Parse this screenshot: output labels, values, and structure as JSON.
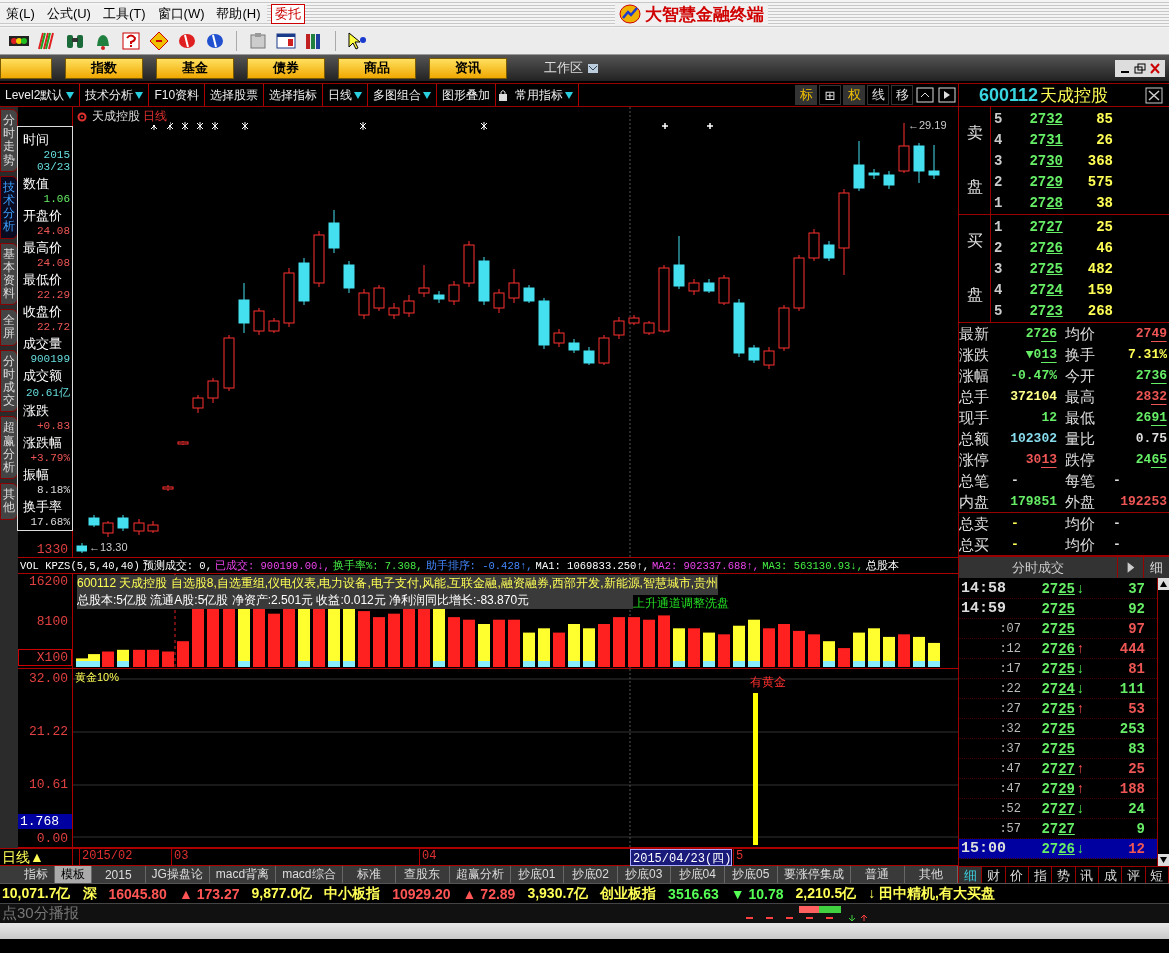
{
  "menu": [
    {
      "label": "策(L)",
      "kind": "plain"
    },
    {
      "label": "公式(U)",
      "kind": "plain"
    },
    {
      "label": "工具(T)",
      "kind": "plain"
    },
    {
      "label": "窗口(W)",
      "kind": "plain"
    },
    {
      "label": "帮助(H)",
      "kind": "plain"
    },
    {
      "label": "委托",
      "kind": "boxed"
    }
  ],
  "app_title": "大智慧金融终端",
  "nav_buttons": [
    "指数",
    "基金",
    "债券",
    "商品",
    "资讯"
  ],
  "workspace": "工作区",
  "chart_toolbar": [
    {
      "label": "Level2默认",
      "dropdown": true
    },
    {
      "label": "技术分析",
      "dropdown": true
    },
    {
      "label": "F10资料",
      "dropdown": false
    },
    {
      "label": "选择股票",
      "dropdown": false
    },
    {
      "label": "选择指标",
      "dropdown": false
    },
    {
      "label": "日线",
      "dropdown": true
    },
    {
      "label": "多图组合",
      "dropdown": true
    },
    {
      "label": "图形叠加",
      "dropdown": false
    },
    {
      "label": "常用指标",
      "dropdown": true
    }
  ],
  "view_buttons": [
    {
      "label": "标",
      "selected": true
    },
    {
      "label": "⊞",
      "selected": false
    },
    {
      "label": "权",
      "selected": true
    },
    {
      "label": "线",
      "selected": false
    },
    {
      "label": "移",
      "selected": false
    }
  ],
  "side_tabs": [
    {
      "label": "分时走势",
      "selected": false
    },
    {
      "label": "技术分析",
      "selected": true
    },
    {
      "label": "基本资料",
      "selected": false
    },
    {
      "label": "全屏",
      "selected": false
    },
    {
      "label": "分时成交",
      "selected": false
    },
    {
      "label": "超赢分析",
      "selected": false
    },
    {
      "label": "其他",
      "selected": false
    }
  ],
  "chart": {
    "stock": "天成控股",
    "period": "日线",
    "max_label": "←29.19",
    "min_label": "←13.30",
    "price_axis": [
      "1330"
    ]
  },
  "info_box": [
    {
      "label": "时间",
      "values": [
        "2015",
        "03/23"
      ],
      "kind": "time"
    },
    {
      "label": "数值",
      "values": [
        "1.06"
      ],
      "kind": "value"
    },
    {
      "label": "开盘价",
      "values": [
        "24.08"
      ],
      "kind": "price"
    },
    {
      "label": "最高价",
      "values": [
        "24.08"
      ],
      "kind": "price"
    },
    {
      "label": "最低价",
      "values": [
        "22.29"
      ],
      "kind": "price"
    },
    {
      "label": "收盘价",
      "values": [
        "22.72"
      ],
      "kind": "price"
    },
    {
      "label": "成交量",
      "values": [
        "900199"
      ],
      "kind": "amount"
    },
    {
      "label": "成交额",
      "values": [
        "20.61亿"
      ],
      "kind": "amount"
    },
    {
      "label": "涨跌",
      "values": [
        "+0.83"
      ],
      "kind": "price"
    },
    {
      "label": "涨跌幅",
      "values": [
        "+3.79%"
      ],
      "kind": "price"
    },
    {
      "label": "振幅",
      "values": [
        "8.18%"
      ],
      "kind": "ratio"
    },
    {
      "label": "换手率",
      "values": [
        "17.68%"
      ],
      "kind": "ratio"
    }
  ],
  "volume": {
    "header": [
      {
        "text": "VOL KPZS(5,5,40,40)",
        "kind": "label"
      },
      {
        "text": "预测成交: 0,",
        "kind": "label"
      },
      {
        "text": "已成交: 900199.00↓,",
        "kind": "traded"
      },
      {
        "text": "换手率%: 7.308,",
        "kind": "turnover"
      },
      {
        "text": "助手排序: -0.428↑,",
        "kind": "rank"
      },
      {
        "text": "MA1: 1069833.250↑,",
        "kind": "label"
      },
      {
        "text": "MA2: 902337.688↑,",
        "kind": "traded"
      },
      {
        "text": "MA3: 563130.93↓,",
        "kind": "turnover"
      },
      {
        "text": "总股本",
        "kind": "label"
      }
    ],
    "info_lines": [
      "600112 天成控股 自选股8,自选重组,仪电仪表,电力设备,电子支付,风能,互联金融,融资融券,西部开发,新能源,智慧城市,贵州",
      "总股本:5亿股 流通A股:5亿股 净资产:2.501元 收益:0.012元 净利润同比增长:-83.870元"
    ],
    "pattern": "上升通道调整洗盘",
    "axis": [
      "16200",
      "8100",
      "X100"
    ]
  },
  "indicator": {
    "name": "黄金10%",
    "signal": "有黄金",
    "axis": [
      "32.00",
      "21.22",
      "10.61",
      "0.00"
    ],
    "current": "1.768"
  },
  "date_axis": {
    "period": "日线▲",
    "labels": [
      {
        "text": "2015/02",
        "selected": false
      },
      {
        "text": "03",
        "selected": false
      },
      {
        "text": "04",
        "selected": false
      },
      {
        "text": "2015/04/23(四)",
        "selected": true
      },
      {
        "text": "5",
        "selected": false
      }
    ]
  },
  "bottom_tabs": [
    {
      "label": "指标",
      "selected": false
    },
    {
      "label": "模板",
      "selected": true
    },
    {
      "label": "2015",
      "selected": false
    },
    {
      "label": "JG操盘论",
      "selected": false
    },
    {
      "label": "macd背离",
      "selected": false
    },
    {
      "label": "macd综合",
      "selected": false
    },
    {
      "label": "标准",
      "selected": false
    },
    {
      "label": "查股东",
      "selected": false
    },
    {
      "label": "超赢分析",
      "selected": false
    },
    {
      "label": "抄底01",
      "selected": false
    },
    {
      "label": "抄底02",
      "selected": false
    },
    {
      "label": "抄底03",
      "selected": false
    },
    {
      "label": "抄底04",
      "selected": false
    },
    {
      "label": "抄底05",
      "selected": false
    },
    {
      "label": "要涨停集成",
      "selected": false
    },
    {
      "label": "普通",
      "selected": false
    },
    {
      "label": "其他",
      "selected": false
    }
  ],
  "ticker": [
    {
      "text": "10,071.7亿",
      "kind": "label"
    },
    {
      "text": "深",
      "kind": "label"
    },
    {
      "text": "16045.80",
      "kind": "up"
    },
    {
      "text": "▲ 173.27",
      "kind": "up"
    },
    {
      "text": "9,877.0亿",
      "kind": "label"
    },
    {
      "text": "中小板指",
      "kind": "label"
    },
    {
      "text": "10929.20",
      "kind": "up"
    },
    {
      "text": "▲ 72.89",
      "kind": "up"
    },
    {
      "text": "3,930.7亿",
      "kind": "label"
    },
    {
      "text": "创业板指",
      "kind": "label"
    },
    {
      "text": "3516.63",
      "kind": "down"
    },
    {
      "text": "▼ 10.78",
      "kind": "down"
    },
    {
      "text": "2,210.5亿",
      "kind": "label"
    },
    {
      "text": "↓ 田中精机,有大买盘",
      "kind": "label"
    }
  ],
  "status": "点30分播报",
  "quote": {
    "code": "600112",
    "name": "天成控股",
    "sell_label": [
      "卖",
      "盘"
    ],
    "buy_label": [
      "买",
      "盘"
    ],
    "sell": [
      {
        "rank": "5",
        "price": "2732",
        "volume": "85"
      },
      {
        "rank": "4",
        "price": "2731",
        "volume": "26"
      },
      {
        "rank": "3",
        "price": "2730",
        "volume": "368"
      },
      {
        "rank": "2",
        "price": "2729",
        "volume": "575"
      },
      {
        "rank": "1",
        "price": "2728",
        "volume": "38"
      }
    ],
    "buy": [
      {
        "rank": "1",
        "price": "2727",
        "volume": "25"
      },
      {
        "rank": "2",
        "price": "2726",
        "volume": "46"
      },
      {
        "rank": "3",
        "price": "2725",
        "volume": "482"
      },
      {
        "rank": "4",
        "price": "2724",
        "volume": "159"
      },
      {
        "rank": "5",
        "price": "2723",
        "volume": "268"
      }
    ],
    "stats": [
      {
        "label": "最新",
        "value": "2726",
        "kind": "down",
        "underlined": true
      },
      {
        "label": "均价",
        "value": "2749",
        "kind": "up",
        "underlined": true
      },
      {
        "label": "涨跌",
        "value": "▼013",
        "kind": "down",
        "underlined": true
      },
      {
        "label": "换手",
        "value": "7.31%",
        "kind": "rate",
        "underlined": false
      },
      {
        "label": "涨幅",
        "value": "-0.47%",
        "kind": "down",
        "underlined": false
      },
      {
        "label": "今开",
        "value": "2736",
        "kind": "down",
        "underlined": true
      },
      {
        "label": "总手",
        "value": "372104",
        "kind": "volume",
        "underlined": false
      },
      {
        "label": "最高",
        "value": "2832",
        "kind": "up",
        "underlined": true
      },
      {
        "label": "现手",
        "value": "12",
        "kind": "down",
        "underlined": false
      },
      {
        "label": "最低",
        "value": "2691",
        "kind": "down",
        "underlined": true
      },
      {
        "label": "总额",
        "value": "102302",
        "kind": "amount",
        "underlined": false
      },
      {
        "label": "量比",
        "value": "0.75",
        "kind": "neutral",
        "underlined": false
      },
      {
        "label": "涨停",
        "value": "3013",
        "kind": "up",
        "underlined": true
      },
      {
        "label": "跌停",
        "value": "2465",
        "kind": "down",
        "underlined": true
      },
      {
        "label": "总笔",
        "value": "-",
        "kind": "neutral",
        "underlined": false
      },
      {
        "label": "每笔",
        "value": "-",
        "kind": "neutral",
        "underlined": false
      },
      {
        "label": "内盘",
        "value": "179851",
        "kind": "down",
        "underlined": false
      },
      {
        "label": "外盘",
        "value": "192253",
        "kind": "up",
        "underlined": false
      }
    ],
    "totals": [
      {
        "label": "总卖",
        "value": "-",
        "kind": "rate",
        "underlined": false
      },
      {
        "label": "均价",
        "value": "-",
        "kind": "neutral",
        "underlined": false
      },
      {
        "label": "总买",
        "value": "-",
        "kind": "rate",
        "underlined": false
      },
      {
        "label": "均价",
        "value": "-",
        "kind": "neutral",
        "underlined": false
      }
    ],
    "trades_title": "分时成交",
    "trades_detail": "细",
    "trades": [
      {
        "time": "14:58",
        "kind": "full",
        "price": "2725",
        "arrow": "↓",
        "rising": false,
        "volume": "37",
        "buy": false,
        "selected": false
      },
      {
        "time": "14:59",
        "kind": "full",
        "price": "2725",
        "volume": "92",
        "buy": false,
        "selected": false
      },
      {
        "time": ":07",
        "kind": "short",
        "price": "2725",
        "volume": "97",
        "buy": true,
        "selected": false
      },
      {
        "time": ":12",
        "kind": "short",
        "price": "2726",
        "arrow": "↑",
        "rising": true,
        "volume": "444",
        "buy": true,
        "selected": false
      },
      {
        "time": ":17",
        "kind": "short",
        "price": "2725",
        "arrow": "↓",
        "rising": false,
        "volume": "81",
        "buy": true,
        "selected": false
      },
      {
        "time": ":22",
        "kind": "short",
        "price": "2724",
        "arrow": "↓",
        "rising": false,
        "volume": "111",
        "buy": false,
        "selected": false
      },
      {
        "time": ":27",
        "kind": "short",
        "price": "2725",
        "arrow": "↑",
        "rising": true,
        "volume": "53",
        "buy": true,
        "selected": false
      },
      {
        "time": ":32",
        "kind": "short",
        "price": "2725",
        "volume": "253",
        "buy": false,
        "selected": false
      },
      {
        "time": ":37",
        "kind": "short",
        "price": "2725",
        "volume": "83",
        "buy": false,
        "selected": false
      },
      {
        "time": ":47",
        "kind": "short",
        "price": "2727",
        "arrow": "↑",
        "rising": true,
        "volume": "25",
        "buy": true,
        "selected": false
      },
      {
        "time": ":47",
        "kind": "short",
        "price": "2729",
        "arrow": "↑",
        "rising": true,
        "volume": "188",
        "buy": true,
        "selected": false
      },
      {
        "time": ":52",
        "kind": "short",
        "price": "2727",
        "arrow": "↓",
        "rising": false,
        "volume": "24",
        "buy": false,
        "selected": false
      },
      {
        "time": ":57",
        "kind": "short",
        "price": "2727",
        "volume": "9",
        "buy": false,
        "selected": false
      },
      {
        "time": "15:00",
        "kind": "full",
        "price": "2726",
        "arrow": "↓",
        "rising": false,
        "volume": "12",
        "buy": true,
        "selected": true
      }
    ],
    "tabs": [
      {
        "label": "细",
        "selected": true
      },
      {
        "label": "财",
        "selected": false
      },
      {
        "label": "价",
        "selected": false
      },
      {
        "label": "指",
        "selected": false
      },
      {
        "label": "势",
        "selected": false
      },
      {
        "label": "讯",
        "selected": false
      },
      {
        "label": "成",
        "selected": false
      },
      {
        "label": "评",
        "selected": false
      },
      {
        "label": "短",
        "selected": false
      }
    ]
  }
}
